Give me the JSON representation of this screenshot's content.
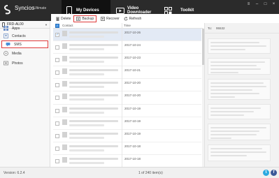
{
  "app": {
    "name": "Syncios",
    "edition": "Ultimate"
  },
  "tabs": [
    {
      "label": "My Devices",
      "icon": "phone-icon",
      "active": true
    },
    {
      "label": "Video Downloader",
      "icon": "video-icon",
      "active": false
    },
    {
      "label": "Toolkit",
      "icon": "toolkit-icon",
      "active": false
    }
  ],
  "device": {
    "name": "FRD-AL00"
  },
  "sidebar": {
    "items": [
      {
        "label": "Apps",
        "icon": "apps-icon"
      },
      {
        "label": "Contacts",
        "icon": "contacts-icon"
      },
      {
        "label": "SMS",
        "icon": "sms-icon",
        "highlighted": true
      },
      {
        "label": "Media",
        "icon": "media-icon"
      },
      {
        "label": "Photos",
        "icon": "photos-icon"
      }
    ]
  },
  "toolbar": {
    "delete": "Delete",
    "backup": "Backup",
    "recover": "Recover",
    "refresh": "Refresh"
  },
  "list": {
    "columns": {
      "contact": "Contact",
      "time": "Time"
    },
    "rows": [
      {
        "time": "2017-10-26",
        "selected": true
      },
      {
        "time": "2017-10-24",
        "selected": false
      },
      {
        "time": "2017-10-23",
        "selected": false
      },
      {
        "time": "2017-10-21",
        "selected": false
      },
      {
        "time": "2017-10-20",
        "selected": false
      },
      {
        "time": "2017-10-20",
        "selected": false
      },
      {
        "time": "2017-10-19",
        "selected": false
      },
      {
        "time": "2017-10-19",
        "selected": false
      },
      {
        "time": "2017-10-19",
        "selected": false
      },
      {
        "time": "2017-10-18",
        "selected": false
      },
      {
        "time": "2017-10-18",
        "selected": false
      }
    ]
  },
  "detail": {
    "to_label": "To:",
    "to_number": "95532"
  },
  "status": {
    "version": "Version: 6.2.4",
    "count": "1 of 240 item(s)"
  },
  "colors": {
    "accent": "#3b8de0",
    "highlight": "#e03a3a",
    "titlebar": "#2b2b2b"
  }
}
